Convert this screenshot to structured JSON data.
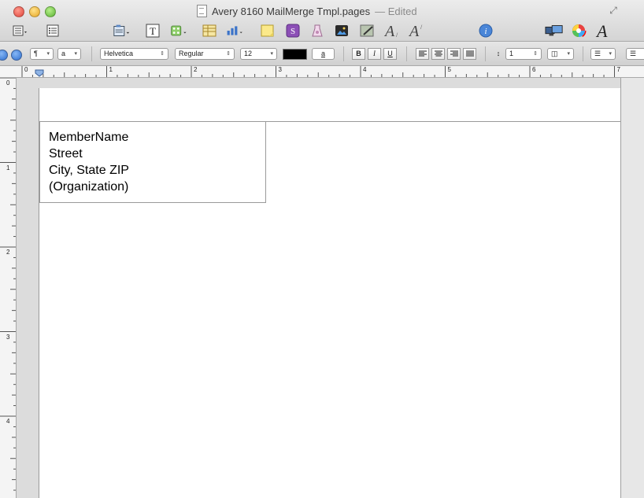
{
  "window": {
    "title": "Avery 8160 MailMerge Tmpl.pages",
    "status": "— Edited"
  },
  "toolbar": {
    "icons": [
      "sections-icon",
      "list-icon",
      "textbox-icon",
      "text-icon",
      "shapes-icon",
      "table-icon",
      "chart-icon",
      "comment-icon",
      "media-icon",
      "adjust-icon",
      "photo-icon",
      "edit-icon",
      "font-size-a-icon",
      "font-size-b-icon",
      "info-icon",
      "colors-icon",
      "fonts-icon"
    ]
  },
  "format_bar": {
    "paragraph_style": "¶",
    "char_style": "a",
    "font_family": "Helvetica",
    "font_style": "Regular",
    "font_size": "12",
    "text_color": "#000000",
    "highlight_label": "a",
    "bold": "B",
    "italic": "I",
    "underline": "U",
    "line_spacing": "1"
  },
  "ruler": {
    "horizontal_marks": [
      "0",
      "1",
      "2",
      "3",
      "4",
      "5",
      "6",
      "7"
    ],
    "vertical_marks": [
      "0",
      "1",
      "2",
      "3",
      "4"
    ]
  },
  "document": {
    "label_lines": [
      "MemberName",
      "Street",
      "City, State ZIP",
      "(Organization)"
    ]
  }
}
